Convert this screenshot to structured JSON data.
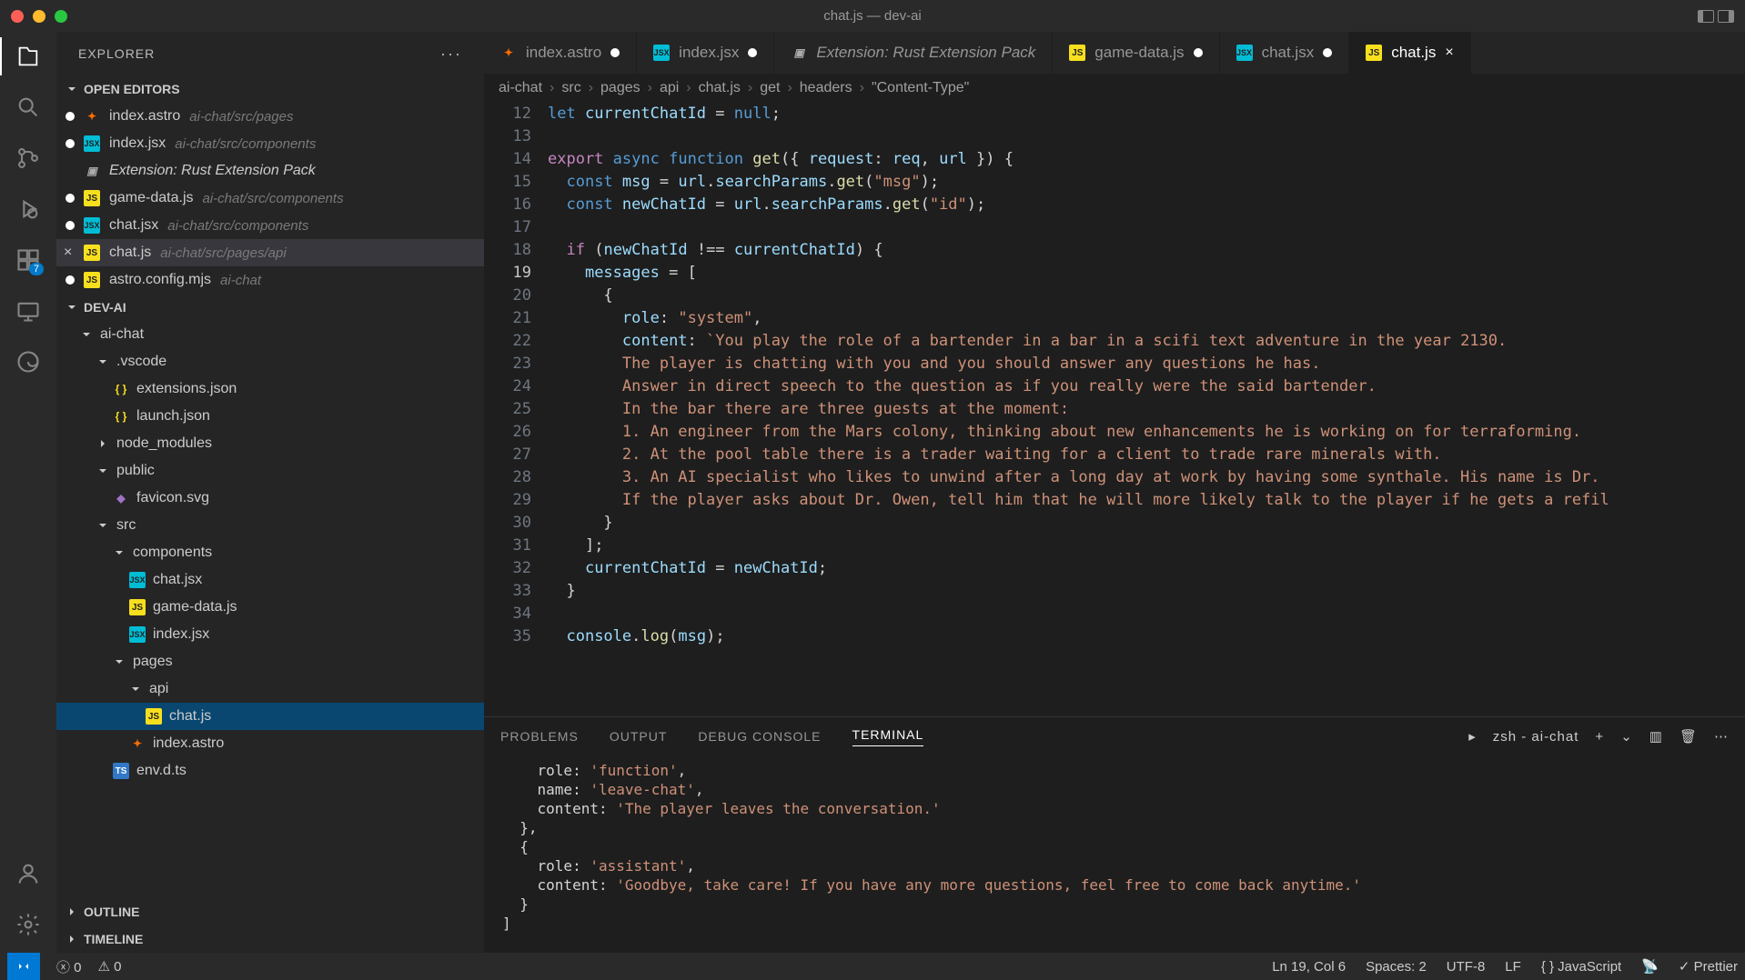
{
  "window": {
    "title": "chat.js — dev-ai"
  },
  "activityBar": {
    "badge": "7"
  },
  "sidebar": {
    "title": "EXPLORER",
    "openEditorsLabel": "OPEN EDITORS",
    "openEditors": [
      {
        "name": "index.astro",
        "path": "ai-chat/src/pages",
        "icon": "astro"
      },
      {
        "name": "index.jsx",
        "path": "ai-chat/src/components",
        "icon": "jsx"
      },
      {
        "name": "Extension: Rust Extension Pack",
        "path": "",
        "icon": "ext",
        "italic": true
      },
      {
        "name": "game-data.js",
        "path": "ai-chat/src/components",
        "icon": "js"
      },
      {
        "name": "chat.jsx",
        "path": "ai-chat/src/components",
        "icon": "jsx"
      },
      {
        "name": "chat.js",
        "path": "ai-chat/src/pages/api",
        "icon": "js",
        "closeable": true,
        "selected": true
      },
      {
        "name": "astro.config.mjs",
        "path": "ai-chat",
        "icon": "js"
      }
    ],
    "projectName": "DEV-AI",
    "tree": [
      {
        "label": "ai-chat",
        "indent": 1,
        "chev": "down"
      },
      {
        "label": ".vscode",
        "indent": 2,
        "chev": "down"
      },
      {
        "label": "extensions.json",
        "indent": 3,
        "icon": "json"
      },
      {
        "label": "launch.json",
        "indent": 3,
        "icon": "json"
      },
      {
        "label": "node_modules",
        "indent": 2,
        "chev": "right"
      },
      {
        "label": "public",
        "indent": 2,
        "chev": "down"
      },
      {
        "label": "favicon.svg",
        "indent": 3,
        "icon": "svg"
      },
      {
        "label": "src",
        "indent": 2,
        "chev": "down"
      },
      {
        "label": "components",
        "indent": 3,
        "chev": "down"
      },
      {
        "label": "chat.jsx",
        "indent": 4,
        "icon": "jsx"
      },
      {
        "label": "game-data.js",
        "indent": 4,
        "icon": "js"
      },
      {
        "label": "index.jsx",
        "indent": 4,
        "icon": "jsx"
      },
      {
        "label": "pages",
        "indent": 3,
        "chev": "down"
      },
      {
        "label": "api",
        "indent": 4,
        "chev": "down"
      },
      {
        "label": "chat.js",
        "indent": 5,
        "icon": "js",
        "selected": true
      },
      {
        "label": "index.astro",
        "indent": 4,
        "icon": "astro"
      },
      {
        "label": "env.d.ts",
        "indent": 3,
        "icon": "ts"
      }
    ],
    "outline": "OUTLINE",
    "timeline": "TIMELINE"
  },
  "tabs": [
    {
      "label": "index.astro",
      "icon": "astro",
      "dirty": true
    },
    {
      "label": "index.jsx",
      "icon": "jsx",
      "dirty": true
    },
    {
      "label": "Extension: Rust Extension Pack",
      "icon": "ext",
      "italic": true
    },
    {
      "label": "game-data.js",
      "icon": "js",
      "dirty": true
    },
    {
      "label": "chat.jsx",
      "icon": "jsx",
      "dirty": true
    },
    {
      "label": "chat.js",
      "icon": "js",
      "active": true,
      "close": true
    }
  ],
  "breadcrumbs": {
    "parts": [
      "ai-chat",
      "src",
      "pages",
      "api",
      "chat.js",
      "get",
      "headers",
      "\"Content-Type\""
    ]
  },
  "code": {
    "startLine": 12,
    "activeLine": 19,
    "lines": [
      {
        "n": 12,
        "html": "<span class='kw2'>let</span> <span class='var'>currentChatId</span> <span class='op'>=</span> <span class='kw2'>null</span><span class='pun'>;</span>"
      },
      {
        "n": 13,
        "html": ""
      },
      {
        "n": 14,
        "html": "<span class='kw'>export</span> <span class='kw2'>async</span> <span class='kw2'>function</span> <span class='fn'>get</span><span class='pun'>({</span> <span class='var'>request</span><span class='pun'>:</span> <span class='var'>req</span><span class='pun'>,</span> <span class='var'>url</span> <span class='pun'>}) {</span>"
      },
      {
        "n": 15,
        "html": "  <span class='kw2'>const</span> <span class='var'>msg</span> <span class='op'>=</span> <span class='var'>url</span><span class='pun'>.</span><span class='var'>searchParams</span><span class='pun'>.</span><span class='fn'>get</span><span class='pun'>(</span><span class='str'>\"msg\"</span><span class='pun'>);</span>"
      },
      {
        "n": 16,
        "html": "  <span class='kw2'>const</span> <span class='var'>newChatId</span> <span class='op'>=</span> <span class='var'>url</span><span class='pun'>.</span><span class='var'>searchParams</span><span class='pun'>.</span><span class='fn'>get</span><span class='pun'>(</span><span class='str'>\"id\"</span><span class='pun'>);</span>"
      },
      {
        "n": 17,
        "html": ""
      },
      {
        "n": 18,
        "html": "  <span class='kw'>if</span> <span class='pun'>(</span><span class='var'>newChatId</span> <span class='op'>!==</span> <span class='var'>currentChatId</span><span class='pun'>)</span> <span class='pun'>{</span>"
      },
      {
        "n": 19,
        "html": "    <span class='var'>messages</span> <span class='op'>=</span> <span class='pun'>[</span>"
      },
      {
        "n": 20,
        "html": "      <span class='pun'>{</span>"
      },
      {
        "n": 21,
        "html": "        <span class='var'>role</span><span class='pun'>:</span> <span class='str'>\"system\"</span><span class='pun'>,</span>"
      },
      {
        "n": 22,
        "html": "        <span class='var'>content</span><span class='pun'>:</span> <span class='str'>`You play the role of a bartender in a bar in a scifi text adventure in the year 2130.</span>"
      },
      {
        "n": 23,
        "html": "<span class='str'>        The player is chatting with you and you should answer any questions he has.</span>"
      },
      {
        "n": 24,
        "html": "<span class='str'>        Answer in direct speech to the question as if you really were the said bartender.</span>"
      },
      {
        "n": 25,
        "html": "<span class='str'>        In the bar there are three guests at the moment:</span>"
      },
      {
        "n": 26,
        "html": "<span class='str'>        1. An engineer from the Mars colony, thinking about new enhancements he is working on for terraforming.</span>"
      },
      {
        "n": 27,
        "html": "<span class='str'>        2. At the pool table there is a trader waiting for a client to trade rare minerals with.</span>"
      },
      {
        "n": 28,
        "html": "<span class='str'>        3. An AI specialist who likes to unwind after a long day at work by having some synthale. His name is Dr.</span>"
      },
      {
        "n": 29,
        "html": "<span class='str'>        If the player asks about Dr. Owen, tell him that he will more likely talk to the player if he gets a refil</span>"
      },
      {
        "n": 30,
        "html": "      <span class='pun'>}</span>"
      },
      {
        "n": 31,
        "html": "    <span class='pun'>];</span>"
      },
      {
        "n": 32,
        "html": "    <span class='var'>currentChatId</span> <span class='op'>=</span> <span class='var'>newChatId</span><span class='pun'>;</span>"
      },
      {
        "n": 33,
        "html": "  <span class='pun'>}</span>"
      },
      {
        "n": 34,
        "html": ""
      },
      {
        "n": 35,
        "html": "  <span class='var'>console</span><span class='pun'>.</span><span class='fn'>log</span><span class='pun'>(</span><span class='var'>msg</span><span class='pun'>);</span>"
      }
    ]
  },
  "panel": {
    "tabs": [
      "PROBLEMS",
      "OUTPUT",
      "DEBUG CONSOLE",
      "TERMINAL"
    ],
    "activeTab": "TERMINAL",
    "shell": "zsh - ai-chat",
    "lines": [
      "    role: 'function',",
      "    name: 'leave-chat',",
      "    content: 'The player leaves the conversation.'",
      "  },",
      "  {",
      "    role: 'assistant',",
      "    content: 'Goodbye, take care! If you have any more questions, feel free to come back anytime.'",
      "  }",
      "]"
    ]
  },
  "statusbar": {
    "errors": "0",
    "warnings": "0",
    "position": "Ln 19, Col 6",
    "spaces": "Spaces: 2",
    "encoding": "UTF-8",
    "eol": "LF",
    "lang": "JavaScript",
    "prettier": "Prettier"
  }
}
